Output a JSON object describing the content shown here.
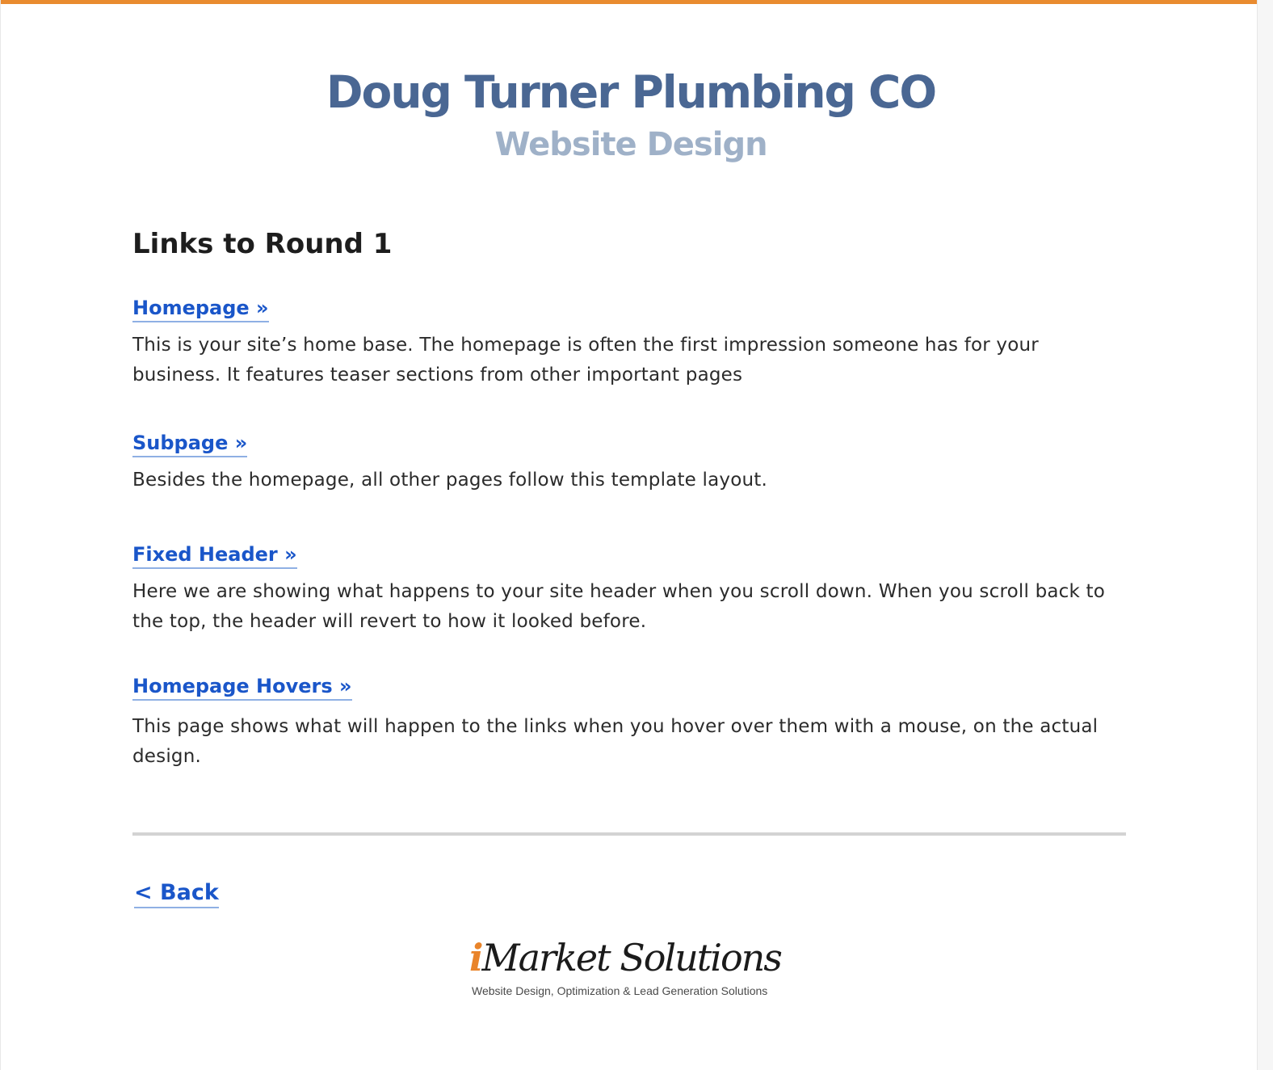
{
  "header": {
    "title": "Doug Turner Plumbing CO",
    "subtitle": "Website Design"
  },
  "main": {
    "section_heading": "Links to Round 1",
    "items": [
      {
        "link": "Homepage »",
        "description": "This is your site’s home base. The homepage is often the first impression someone has for your business. It features teaser sections from other important pages"
      },
      {
        "link": "Subpage »",
        "description": "Besides the homepage, all other pages follow this template layout."
      },
      {
        "link": "Fixed Header »",
        "description": "Here we are showing what happens to your site header when you scroll down. When you scroll back to the top, the header will revert to how it looked before."
      },
      {
        "link": "Homepage Hovers »",
        "description": "This page shows what will happen to the links when you hover over them with a mouse, on the actual design."
      }
    ]
  },
  "footer": {
    "back_label": "< Back",
    "logo": {
      "brand_i": "i",
      "brand_rest": "Market Solutions",
      "tagline": "Website Design, Optimization & Lead Generation Solutions"
    }
  },
  "colors": {
    "accent_bar": "#e98b2f",
    "title": "#4a6793",
    "subtitle": "#9fb1c8",
    "link": "#1a56c9",
    "logo_accent": "#e9842a"
  }
}
